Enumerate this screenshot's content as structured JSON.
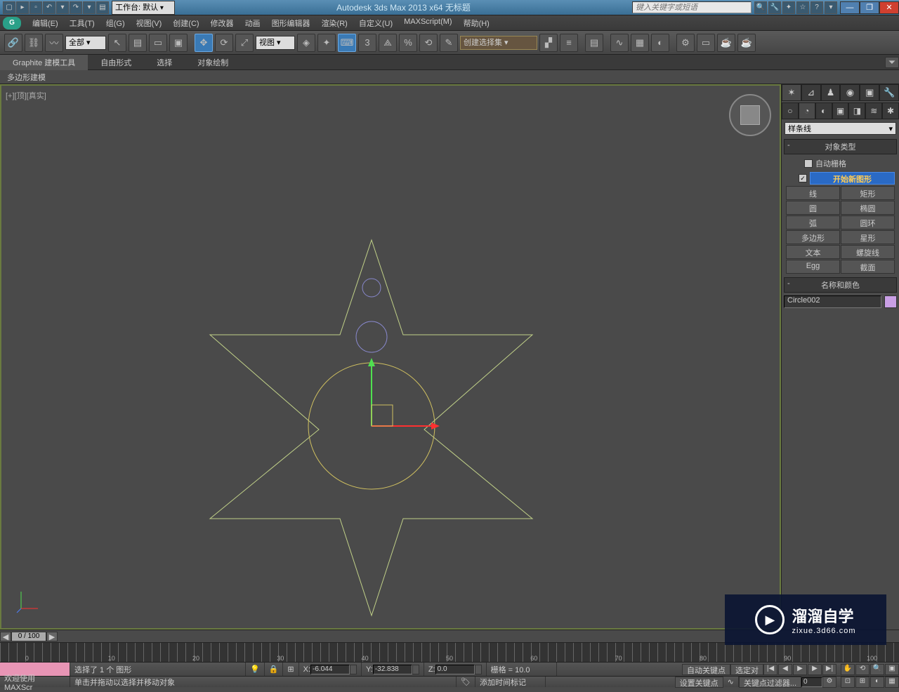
{
  "titlebar": {
    "workspace_label": "工作台: 默认",
    "app_title": "Autodesk 3ds Max  2013 x64     无标题",
    "search_placeholder": "键入关键字或短语"
  },
  "menus": [
    "编辑(E)",
    "工具(T)",
    "组(G)",
    "视图(V)",
    "创建(C)",
    "修改器",
    "动画",
    "图形编辑器",
    "渲染(R)",
    "自定义(U)",
    "MAXScript(M)",
    "帮助(H)"
  ],
  "toolbar": {
    "filter_dropdown": "全部",
    "ref_dropdown": "视图",
    "named_set_dropdown": "创建选择集"
  },
  "ribbon": {
    "tabs": [
      "Graphite 建模工具",
      "自由形式",
      "选择",
      "对象绘制"
    ],
    "sub": "多边形建模"
  },
  "viewport": {
    "label": "[+][顶][真实]"
  },
  "cmdpanel": {
    "category_dropdown": "样条线",
    "rollout_objtype": "对象类型",
    "autogrid_label": "自动栅格",
    "newshape_label": "开始新图形",
    "shape_buttons": [
      "线",
      "矩形",
      "圆",
      "椭圆",
      "弧",
      "圆环",
      "多边形",
      "星形",
      "文本",
      "螺旋线",
      "Egg",
      "截面"
    ],
    "rollout_namecolor": "名称和颜色",
    "object_name": "Circle002"
  },
  "timeline": {
    "range": "0 / 100",
    "marks": [
      0,
      10,
      20,
      30,
      40,
      50,
      60,
      70,
      80,
      90,
      100
    ]
  },
  "status": {
    "selection": "选择了 1 个 图形",
    "x_label": "X:",
    "x_val": "-6.044",
    "y_label": "Y:",
    "y_val": "-32.838",
    "z_label": "Z:",
    "z_val": "0.0",
    "grid": "栅格 = 10.0",
    "autokey": "自动关键点",
    "setkey": "设置关键点",
    "selected_lock": "选定对",
    "keyfilter": "关键点过滤器...",
    "welcome": "欢迎使用  MAXScr",
    "hint": "单击并拖动以选择并移动对象",
    "addtimemark": "添加时间标记"
  },
  "watermark": {
    "main": "溜溜自学",
    "sub": "zixue.3d66.com"
  }
}
